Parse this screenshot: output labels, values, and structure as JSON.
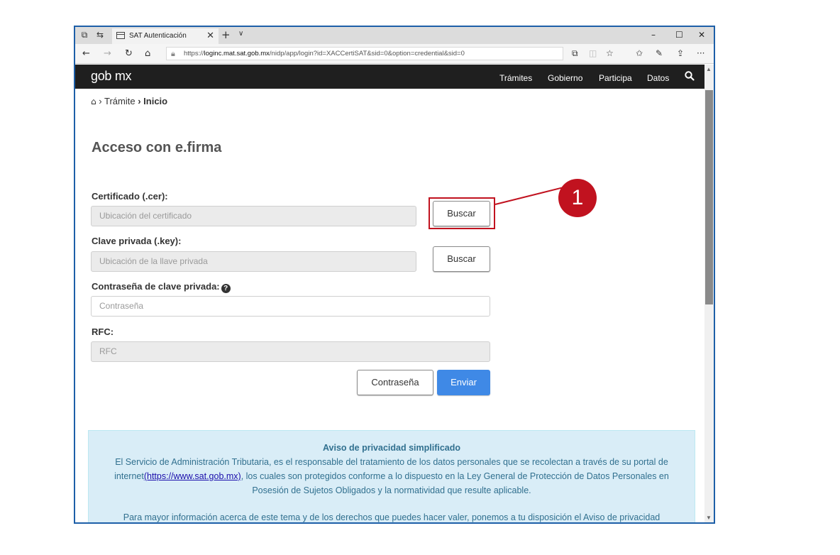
{
  "browser": {
    "tab_title": "SAT Autenticación",
    "tab_close": "✕",
    "new_tab": "+",
    "tab_menu": "∨",
    "minimize": "–",
    "maximize": "☐",
    "close": "✕",
    "back": "←",
    "forward": "→",
    "refresh": "↻",
    "home": "⌂",
    "url_prefix": "https://",
    "url_host": "loginc.mat.sat.gob.mx",
    "url_path": "/nidp/app/login?id=XACCertiSAT&sid=0&option=credential&sid=0",
    "tools": [
      "⧉",
      "◫",
      "☆",
      "✩",
      "✎",
      "⇪",
      "···"
    ]
  },
  "site": {
    "logo": "gob mx",
    "nav": [
      "Trámites",
      "Gobierno",
      "Participa",
      "Datos"
    ]
  },
  "breadcrumb": {
    "home_icon": "⌂",
    "sep1": "›",
    "item1": "Trámite",
    "sep2": "›",
    "item2": "Inicio"
  },
  "form": {
    "title": "Acceso con e.firma",
    "cert_label": "Certificado (.cer):",
    "cert_placeholder": "Ubicación del certificado",
    "cert_button": "Buscar",
    "key_label": "Clave privada (.key):",
    "key_placeholder": "Ubicación de la llave privada",
    "key_button": "Buscar",
    "password_label": "Contraseña de clave privada:",
    "password_placeholder": "Contraseña",
    "rfc_label": "RFC:",
    "rfc_placeholder": "RFC",
    "password_button": "Contraseña",
    "submit_button": "Enviar"
  },
  "privacy": {
    "title": "Aviso de privacidad simplificado",
    "body_start": "El Servicio de Administración Tributaria, es el responsable del tratamiento de los datos personales que se recolectan a través de su portal de internet",
    "link": "(https://www.sat.gob.mx)",
    "body_end": ", los cuales son protegidos conforme a lo dispuesto en la Ley General de Protección de Datos Personales en Posesión de Sujetos Obligados y la normatividad que resulte aplicable.",
    "more": "Para mayor información acerca de este tema y de los derechos que puedes hacer valer, ponemos a tu disposición el Aviso de privacidad"
  },
  "annotation": {
    "marker": "1",
    "color": "#c1121f"
  }
}
